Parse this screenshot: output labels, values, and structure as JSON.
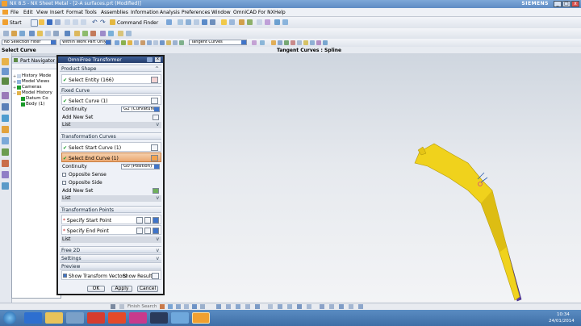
{
  "window": {
    "title": "NX 8.5 - NX Sheet Metal - [2-A surfaces.prt (Modified)]",
    "brand": "SIEMENS",
    "minimize": "_",
    "maximize": "□",
    "close": "x"
  },
  "menu": [
    "File",
    "Edit",
    "View",
    "Insert",
    "Format",
    "Tools",
    "Assemblies",
    "Information",
    "Analysis",
    "Preferences",
    "Window",
    "OmniCAD For NX",
    "Help"
  ],
  "toolbar": {
    "start_label": "Start",
    "command_finder_label": "Command Finder",
    "selection_filter": "No Selection Filter",
    "work_part_filter": "Within Work Part Only",
    "curve_rule": "Tangent Curves"
  },
  "status": {
    "prompt": "Select Curve",
    "selection_info": "Tangent Curves : Spline"
  },
  "navigator": {
    "title": "Part Navigator",
    "items": [
      {
        "label": "History Mode"
      },
      {
        "label": "Model Views"
      },
      {
        "label": "Cameras"
      },
      {
        "label": "Model History"
      },
      {
        "label": "Datum Co"
      },
      {
        "label": "Body (1)"
      }
    ]
  },
  "dialog": {
    "title": "OmniFree Transformer",
    "product_shape": {
      "header": "Product Shape",
      "select_entity": "Select Entity (166)"
    },
    "fixed_curve": {
      "header": "Fixed Curve",
      "select_curve": "Select Curve (1)",
      "continuity_label": "Continuity",
      "continuity_value": "G2 (Curvature)",
      "add_new_set": "Add New Set",
      "list_label": "List"
    },
    "transformation_curves": {
      "header": "Transformation Curves",
      "select_start": "Select Start Curve (1)",
      "select_end": "Select End Curve (1)",
      "continuity_label": "Continuity",
      "continuity_value": "G0 (Position)",
      "opposite_sense": "Opposite Sense",
      "opposite_side": "Opposite Side",
      "add_new_set": "Add New Set",
      "list_label": "List"
    },
    "transformation_points": {
      "header": "Transformation Points",
      "start_point": "Specify Start Point",
      "end_point": "Specify End Point",
      "list_label": "List"
    },
    "free_2d": "Free 2D",
    "settings": "Settings",
    "preview": {
      "header": "Preview",
      "show_vectors": "Show Transform Vectors",
      "show_result": "Show Result",
      "show_vectors_checked": true
    },
    "ok": "OK",
    "apply": "Apply",
    "cancel": "Cancel"
  },
  "bottom_bar": {
    "finish_search": "Finish Search"
  },
  "taskbar": {
    "time": "10:34",
    "date": "24/01/2014"
  },
  "colors": {
    "surface_yellow": "#f0d21c",
    "surface_purple": "#5a3aa8",
    "dialog_title": "#2e4b7f",
    "highlight_orange": "#eaa770"
  }
}
